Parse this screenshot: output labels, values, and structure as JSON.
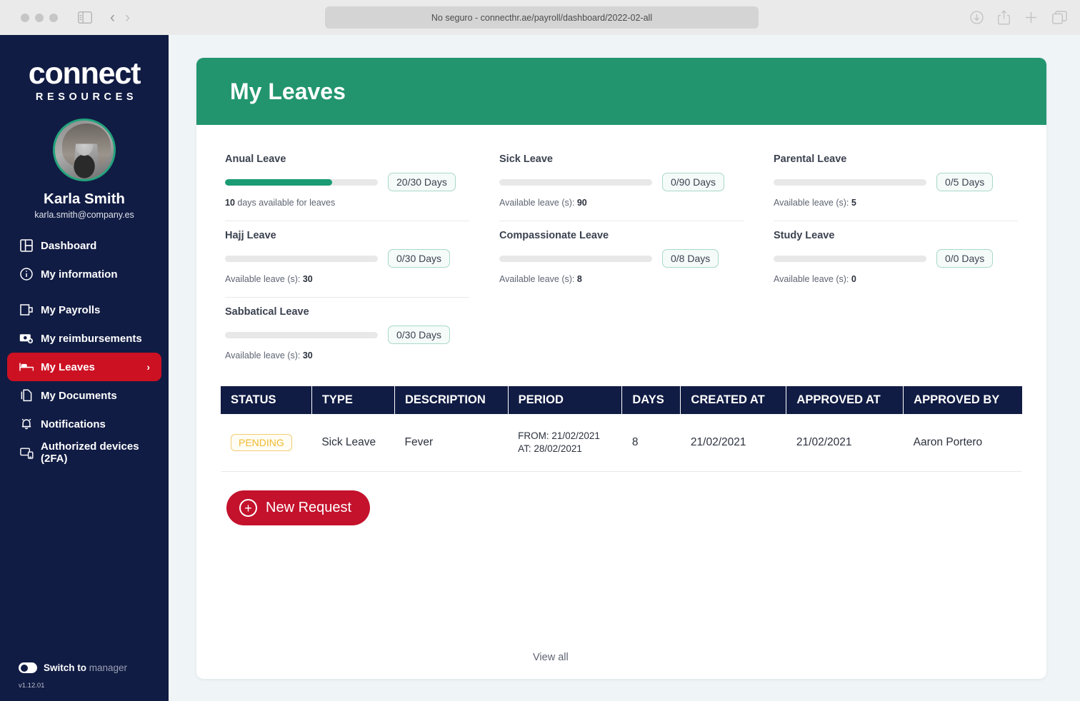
{
  "browser": {
    "url_text": "No seguro - connecthr.ae/payroll/dashboard/2022-02-all",
    "back_label": "‹",
    "forward_label": "›"
  },
  "sidebar": {
    "logo_main": "connect",
    "logo_sub": "RESOURCES",
    "user_name": "Karla Smith",
    "user_email": "karla.smith@company.es",
    "items": [
      {
        "label": "Dashboard",
        "icon": "dashboard-icon",
        "active": false
      },
      {
        "label": "My information",
        "icon": "info-icon",
        "active": false
      },
      {
        "label": "My Payrolls",
        "icon": "wallet-icon",
        "active": false
      },
      {
        "label": "My reimbursements",
        "icon": "money-plus-icon",
        "active": false
      },
      {
        "label": "My Leaves",
        "icon": "bed-icon",
        "active": true,
        "chevron": "›"
      },
      {
        "label": "My Documents",
        "icon": "document-icon",
        "active": false
      },
      {
        "label": "Notifications",
        "icon": "bell-icon",
        "active": false
      },
      {
        "label": "Authorized devices (2FA)",
        "icon": "devices-icon",
        "active": false
      }
    ],
    "switch_bold": "Switch to",
    "switch_muted": "manager",
    "version": "v1.12.01"
  },
  "header": {
    "title": "My Leaves"
  },
  "leaves": [
    {
      "name": "Anual Leave",
      "pill": "20/30 Days",
      "percent": 70,
      "sub_prefix": "",
      "sub_value": "10",
      "sub_suffix": " days available for leaves",
      "value_first": true
    },
    {
      "name": "Sick Leave",
      "pill": "0/90 Days",
      "percent": 0,
      "sub_prefix": "Available leave (s): ",
      "sub_value": "90",
      "sub_suffix": "",
      "value_first": false
    },
    {
      "name": "Parental Leave",
      "pill": "0/5 Days",
      "percent": 0,
      "sub_prefix": "Available leave (s): ",
      "sub_value": "5",
      "sub_suffix": "",
      "value_first": false
    },
    {
      "name": "Hajj Leave",
      "pill": "0/30 Days",
      "percent": 0,
      "sub_prefix": "Available leave (s): ",
      "sub_value": "30",
      "sub_suffix": "",
      "value_first": false
    },
    {
      "name": "Compassionate Leave",
      "pill": "0/8 Days",
      "percent": 0,
      "sub_prefix": "Available leave (s): ",
      "sub_value": "8",
      "sub_suffix": "",
      "value_first": false
    },
    {
      "name": "Study Leave",
      "pill": "0/0 Days",
      "percent": 0,
      "sub_prefix": "Available leave (s): ",
      "sub_value": "0",
      "sub_suffix": "",
      "value_first": false
    },
    {
      "name": "Sabbatical Leave",
      "pill": "0/30 Days",
      "percent": 0,
      "sub_prefix": "Available leave (s): ",
      "sub_value": "30",
      "sub_suffix": "",
      "value_first": false
    }
  ],
  "table": {
    "columns": [
      "STATUS",
      "TYPE",
      "DESCRIPTION",
      "PERIOD",
      "DAYS",
      "CREATED AT",
      "APPROVED AT",
      "APPROVED BY"
    ],
    "rows": [
      {
        "status": "PENDING",
        "type": "Sick Leave",
        "description": "Fever",
        "period_from": "FROM: 21/02/2021",
        "period_at": "AT: 28/02/2021",
        "days": "8",
        "created_at": "21/02/2021",
        "approved_at": "21/02/2021",
        "approved_by": "Aaron Portero"
      }
    ]
  },
  "actions": {
    "new_request": "New Request",
    "new_request_icon": "+",
    "view_all": "View all"
  },
  "colors": {
    "sidebar": "#111c44",
    "header_green": "#22956f",
    "accent_red": "#c4122c",
    "active_nav_red": "#cc1122",
    "progress_green": "#1a9b73",
    "pending_amber": "#f0b92f"
  }
}
